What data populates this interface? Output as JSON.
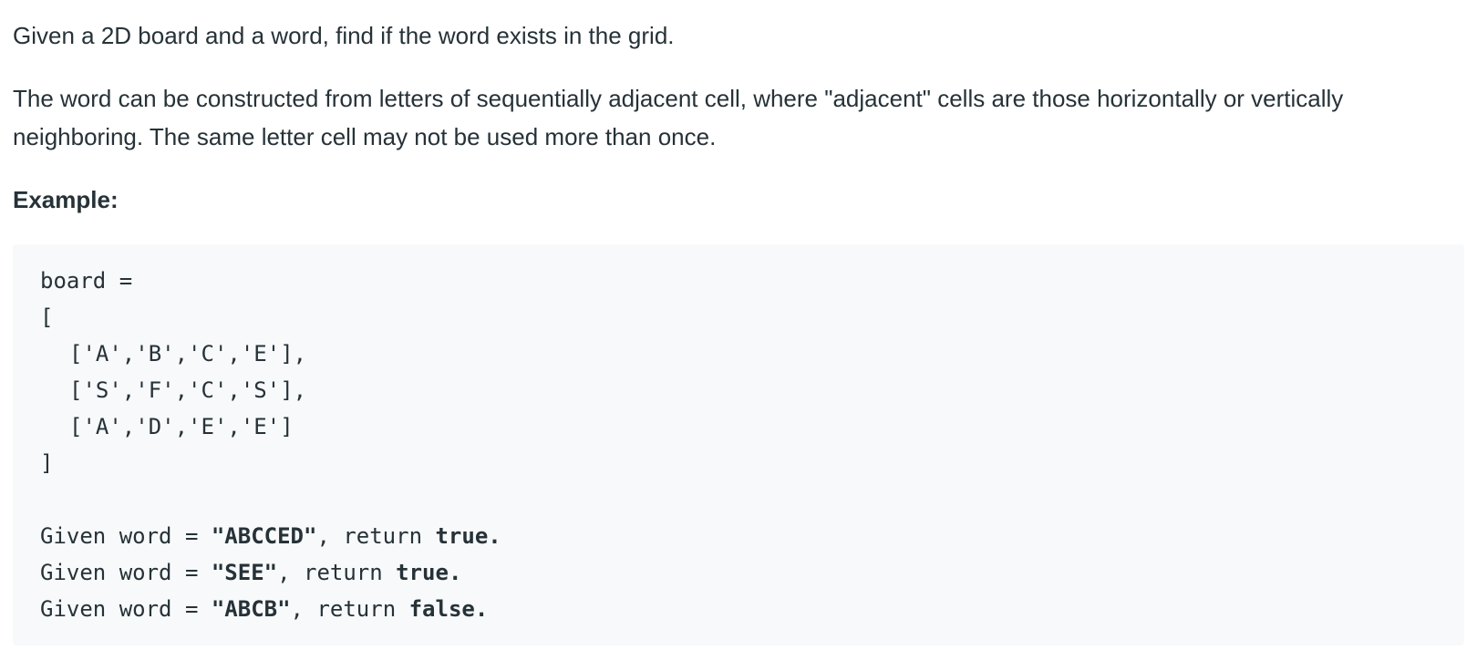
{
  "description": {
    "paragraph_1": "Given a 2D board and a word, find if the word exists in the grid.",
    "paragraph_2": "The word can be constructed from letters of sequentially adjacent cell, where \"adjacent\" cells are those horizontally or vertically neighboring. The same letter cell may not be used more than once."
  },
  "example": {
    "heading": "Example:",
    "code": {
      "board_decl": "board =",
      "open_bracket": "[",
      "rows": [
        "['A','B','C','E'],",
        "['S','F','C','S'],",
        "['A','D','E','E']"
      ],
      "close_bracket": "]",
      "cases": [
        {
          "prefix": "Given word = ",
          "word": "\"ABCCED\"",
          "middle": ", return ",
          "result": "true."
        },
        {
          "prefix": "Given word = ",
          "word": "\"SEE\"",
          "middle": ", return ",
          "result": "true."
        },
        {
          "prefix": "Given word = ",
          "word": "\"ABCB\"",
          "middle": ", return ",
          "result": "false."
        }
      ]
    }
  }
}
